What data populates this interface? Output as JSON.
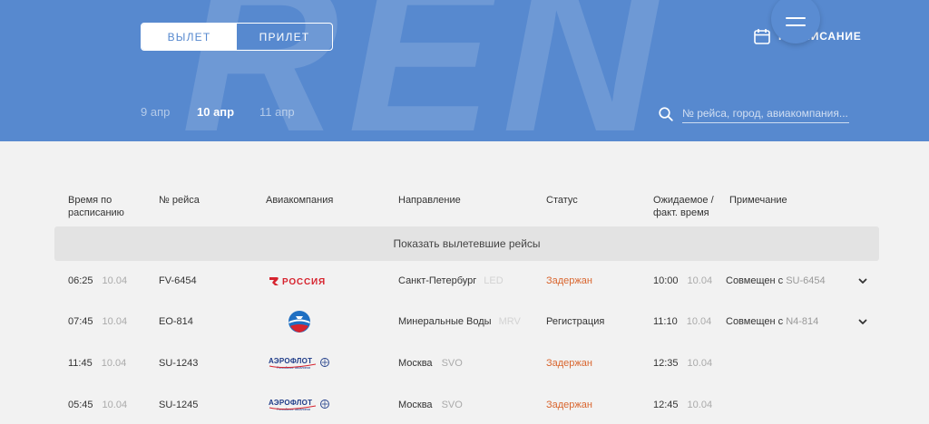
{
  "header": {
    "watermark_text": "REN",
    "toggle": {
      "departure_label": "ВЫЛЕТ",
      "arrival_label": "ПРИЛЕТ",
      "selected": "departure"
    },
    "schedule_label": "РАСПИСАНИЕ",
    "dates": [
      {
        "label": "9 апр",
        "state": "muted"
      },
      {
        "label": "10 апр",
        "state": "active"
      },
      {
        "label": "11 апр",
        "state": "muted"
      }
    ],
    "search": {
      "placeholder": "№ рейса, город, авиакомпания..."
    }
  },
  "table": {
    "headers": {
      "scheduled_time": [
        "Время по",
        "расписанию"
      ],
      "flight_no": "№ рейса",
      "airline": "Авиакомпания",
      "direction": "Направление",
      "status": "Статус",
      "expected_time": [
        "Ожидаемое /",
        "факт. время"
      ],
      "note": "Примечание"
    },
    "show_departed_label": "Показать вылетевшие рейсы",
    "rows": [
      {
        "time": "06:25",
        "date": "10.04",
        "flight": "FV-6454",
        "airline_logo": "rossiya-logo",
        "city": "Санкт-Петербург",
        "code": "LED",
        "status": "Задержан",
        "status_kind": "delayed",
        "exp_time": "10:00",
        "exp_date": "10.04",
        "note_prefix": "Совмещен с",
        "note_code": "SU-6454",
        "expandable": true
      },
      {
        "time": "07:45",
        "date": "10.04",
        "flight": "EO-814",
        "airline_logo": "ikar-logo",
        "city": "Минеральные Воды",
        "code": "MRV",
        "status": "Регистрация",
        "status_kind": "normal",
        "exp_time": "11:10",
        "exp_date": "10.04",
        "note_prefix": "Совмещен с",
        "note_code": "N4-814",
        "expandable": true
      },
      {
        "time": "11:45",
        "date": "10.04",
        "flight": "SU-1243",
        "airline_logo": "aeroflot-logo",
        "city": "Москва",
        "code": "SVO",
        "status": "Задержан",
        "status_kind": "delayed",
        "exp_time": "12:35",
        "exp_date": "10.04",
        "note_prefix": "",
        "note_code": "",
        "expandable": false
      },
      {
        "time": "05:45",
        "date": "10.04",
        "flight": "SU-1245",
        "airline_logo": "aeroflot-logo",
        "city": "Москва",
        "code": "SVO",
        "status": "Задержан",
        "status_kind": "delayed",
        "exp_time": "12:45",
        "exp_date": "10.04",
        "note_prefix": "",
        "note_code": "",
        "expandable": false
      }
    ]
  },
  "logos": {
    "rossiya_text": "РОССИЯ",
    "aeroflot_text": "АЭРОФЛОТ",
    "aeroflot_sub": "Российские авиалинии"
  },
  "colors": {
    "brand_blue": "#5789cf",
    "delayed": "#d9662f",
    "rossiya_red": "#d6232e",
    "aeroflot_blue": "#1f3c88"
  }
}
